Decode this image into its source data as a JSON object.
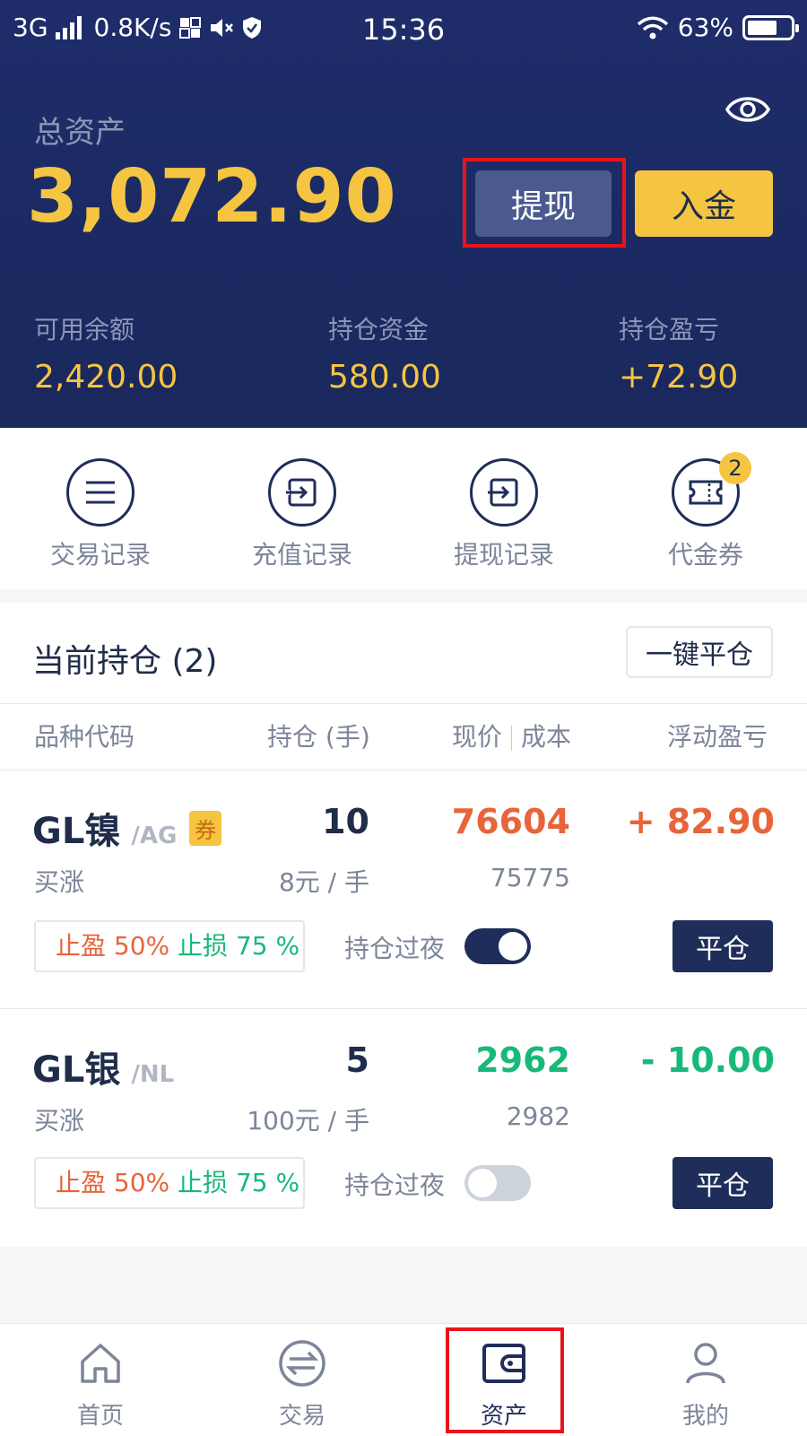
{
  "status_bar": {
    "network": "3G",
    "speed": "0.8K/s",
    "time": "15:36",
    "battery": "63%",
    "battery_level": 0.63
  },
  "summary": {
    "total_label": "总资产",
    "total_value": "3,072.90",
    "withdraw_label": "提现",
    "deposit_label": "入金",
    "stats": [
      {
        "label": "可用余额",
        "value": "2,420.00"
      },
      {
        "label": "持仓资金",
        "value": "580.00"
      },
      {
        "label": "持仓盈亏",
        "value": "+72.90"
      }
    ]
  },
  "quick_actions": [
    {
      "label": "交易记录",
      "icon": "list-icon"
    },
    {
      "label": "充值记录",
      "icon": "deposit-record-icon"
    },
    {
      "label": "提现记录",
      "icon": "withdraw-record-icon"
    },
    {
      "label": "代金券",
      "icon": "ticket-icon",
      "badge": "2"
    }
  ],
  "holdings": {
    "title": "当前持仓 (2)",
    "close_all_label": "一键平仓",
    "columns": {
      "code": "品种代码",
      "qty": "持仓 (手)",
      "price": "现价",
      "cost": "成本",
      "pnl": "浮动盈亏"
    },
    "positions": [
      {
        "name": "GL镍",
        "code": "/AG",
        "coupon": "券",
        "qty": "10",
        "price": "76604",
        "pnl": "+ 82.90",
        "direction": "买涨",
        "unit": "8元 / 手",
        "cost": "75775",
        "tp": "止盈 50%",
        "sl": "止损 75 %",
        "overnight_label": "持仓过夜",
        "overnight_on": true,
        "close_label": "平仓"
      },
      {
        "name": "GL银",
        "code": "/NL",
        "qty": "5",
        "price": "2962",
        "pnl": "- 10.00",
        "direction": "买涨",
        "unit": "100元 / 手",
        "cost": "2982",
        "tp": "止盈 50%",
        "sl": "止损 75 %",
        "overnight_label": "持仓过夜",
        "overnight_on": false,
        "close_label": "平仓"
      }
    ]
  },
  "bottom_nav": [
    {
      "label": "首页",
      "icon": "home-icon"
    },
    {
      "label": "交易",
      "icon": "exchange-icon"
    },
    {
      "label": "资产",
      "icon": "wallet-icon",
      "active": true
    },
    {
      "label": "我的",
      "icon": "user-icon"
    }
  ],
  "colors": {
    "header_bg": "#1e2d6a",
    "accent_gold": "#f5c542",
    "profit_red": "#e8643a",
    "loss_green": "#18b978",
    "highlight": "#e8141c"
  }
}
